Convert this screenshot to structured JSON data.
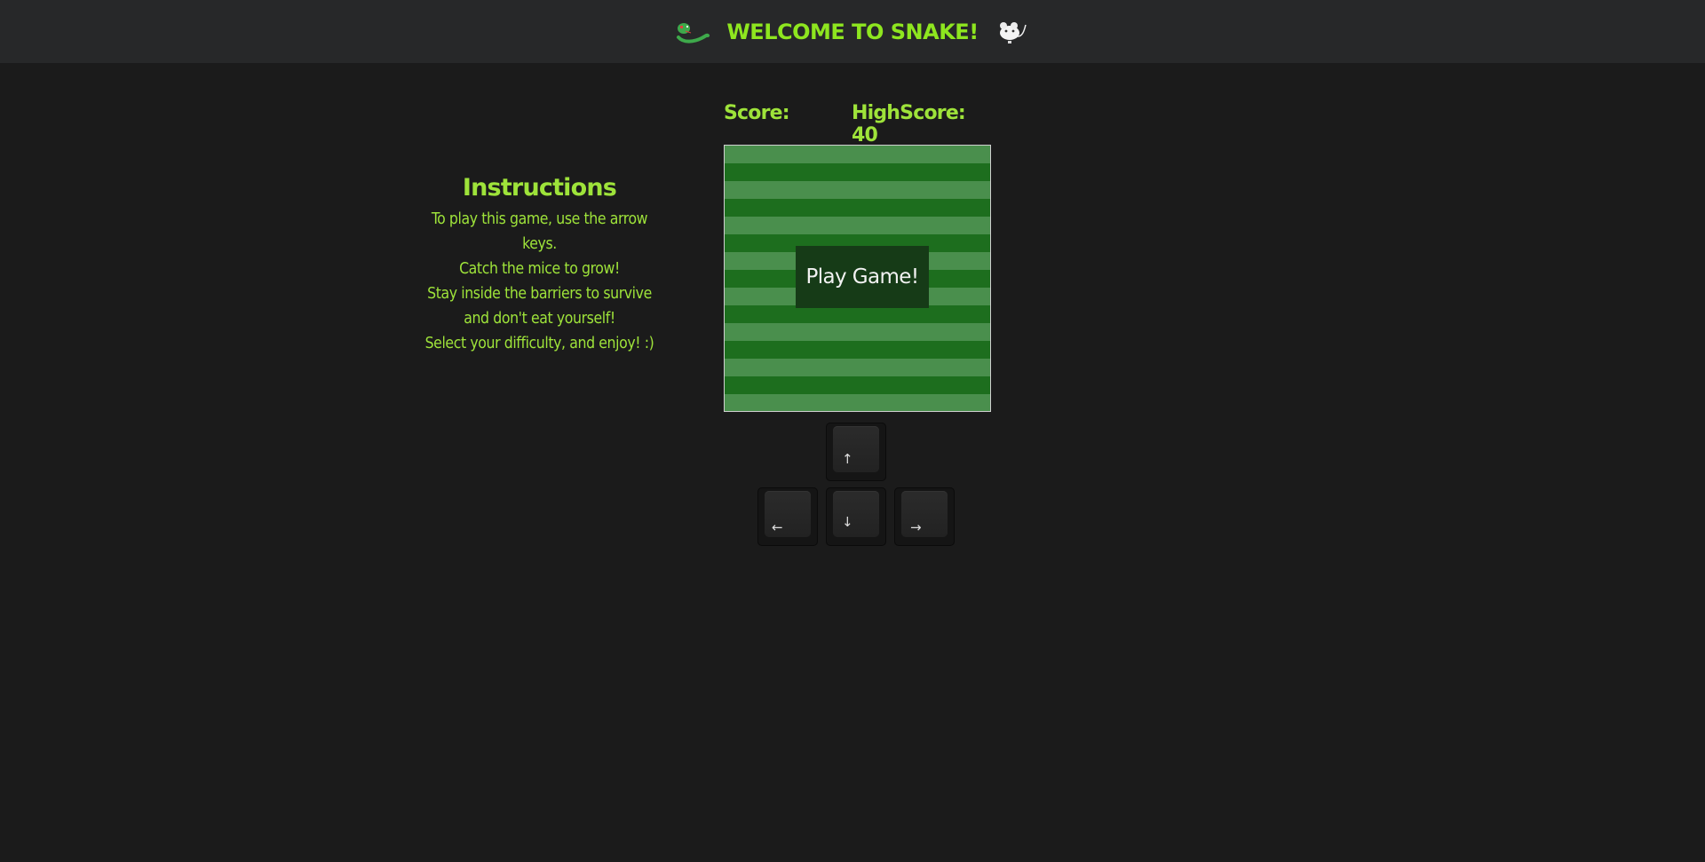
{
  "header": {
    "title": "WELCOME TO SNAKE!",
    "left_icon": "snake-icon",
    "right_icon": "mouse-icon"
  },
  "instructions": {
    "heading": "Instructions",
    "lines": [
      "To play this game, use the arrow",
      "keys.",
      "Catch the mice to grow!",
      "Stay inside the barriers to survive",
      "and don't eat yourself!",
      "Select your difficulty, and enjoy! :)"
    ]
  },
  "scoreboard": {
    "score_label": "Score:",
    "score_value": "",
    "highscore_text": "HighScore: 40"
  },
  "board": {
    "play_label": "Play Game!",
    "colors": {
      "light_stripe": "#4a8f4d",
      "dark_stripe": "#1d6e1e",
      "button_bg": "#163b17"
    }
  },
  "controls": {
    "up": "↑",
    "left": "←",
    "down": "↓",
    "right": "→"
  },
  "theme": {
    "accent": "#8ee61f",
    "background": "#1b1b1b",
    "header_bg": "#272829"
  }
}
